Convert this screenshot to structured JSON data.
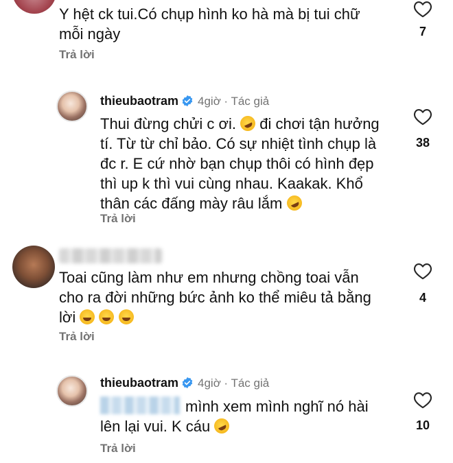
{
  "comments": [
    {
      "text_lines": [
        "Y hệt ck tui.Có chụp hình ko hà mà bị tui chữ",
        "mỗi ngày"
      ],
      "likes": "7",
      "reply_label": "Trả lời"
    },
    {
      "username": "thieubaotram",
      "time": "4giờ",
      "dot": "·",
      "author_label": "Tác giả",
      "text_lines": [
        "Thui đừng chửi c ơi.",
        "đi chơi tận hưởng",
        "tí. Từ từ chỉ bảo. Có sự nhiệt tình chụp là",
        "đc r. E cứ nhờ bạn chụp thôi có hình đẹp",
        "thì up k thì vui cùng nhau. Kaakak. Khổ",
        "thân các đấng mày râu lắm"
      ],
      "likes": "38",
      "reply_label": "Trả lời"
    },
    {
      "text_lines": [
        "Toai cũng làm như em nhưng chồng toai vẫn",
        "cho ra đời những bức ảnh ko thể miêu tả bằng",
        "lời"
      ],
      "likes": "4",
      "reply_label": "Trả lời"
    },
    {
      "username": "thieubaotram",
      "time": "4giờ",
      "dot": "·",
      "author_label": "Tác giả",
      "text_lines": [
        "mình xem mình nghĩ nó hài",
        "lên lại vui. K cáu"
      ],
      "likes": "10",
      "reply_label": "Trả lời"
    }
  ],
  "icons": {
    "heart": "heart-outline-icon",
    "verified": "verified-badge-icon",
    "emoji_rofl": "rolling-on-floor-laughing-emoji",
    "emoji_joy": "tears-of-joy-emoji"
  },
  "colors": {
    "verified": "#3897f0",
    "muted": "#737373",
    "text": "#111111"
  }
}
